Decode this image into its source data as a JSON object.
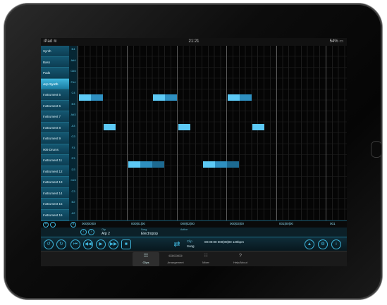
{
  "status": {
    "carrier": "iPad",
    "wifi": "wifi-icon",
    "time": "21:21",
    "battery": "54%"
  },
  "tracks": [
    "Synth",
    "Bass",
    "Pads",
    "Arp Synth",
    "Instrument 5",
    "Instrument 6",
    "Instrument 7",
    "Instrument 8",
    "Instrument 9",
    "909 Drums",
    "Instrument 11",
    "Instrument 12",
    "Instrument 13",
    "Instrument 14",
    "Instrument 15",
    "Instrument 16"
  ],
  "selected_track": "Arp Synth",
  "keys": [
    "B4",
    "A#4",
    "G#4",
    "F#4",
    "C4",
    "B3",
    "A#3",
    "A3",
    "G3",
    "F3",
    "E3",
    "D3",
    "C#3",
    "C3",
    "B2",
    "A2"
  ],
  "timeline": {
    "labels": [
      "000|00|00",
      "000|01|00",
      "000|02|00",
      "000|03|00",
      "001|00|00",
      "001"
    ]
  },
  "info": {
    "clip_label": "Clip",
    "clip_value": "Arp 2",
    "song_label": "Song",
    "song_value": "Electropop",
    "author_label": "Author",
    "author_value": ""
  },
  "transport": {
    "clip_label": "Clip",
    "song_label": "Song",
    "clip_time": "00:00:00  000|00|00  120bpm",
    "song_time": ""
  },
  "tabs": [
    {
      "label": "Clips",
      "active": true
    },
    {
      "label": "Arrangement",
      "active": false
    },
    {
      "label": "Mixer",
      "active": false
    },
    {
      "label": "Help/About",
      "active": false
    }
  ],
  "colors": {
    "accent": "#3fb6dd",
    "note": "#5cc9f5",
    "note_dim": "#2e8fc0"
  }
}
